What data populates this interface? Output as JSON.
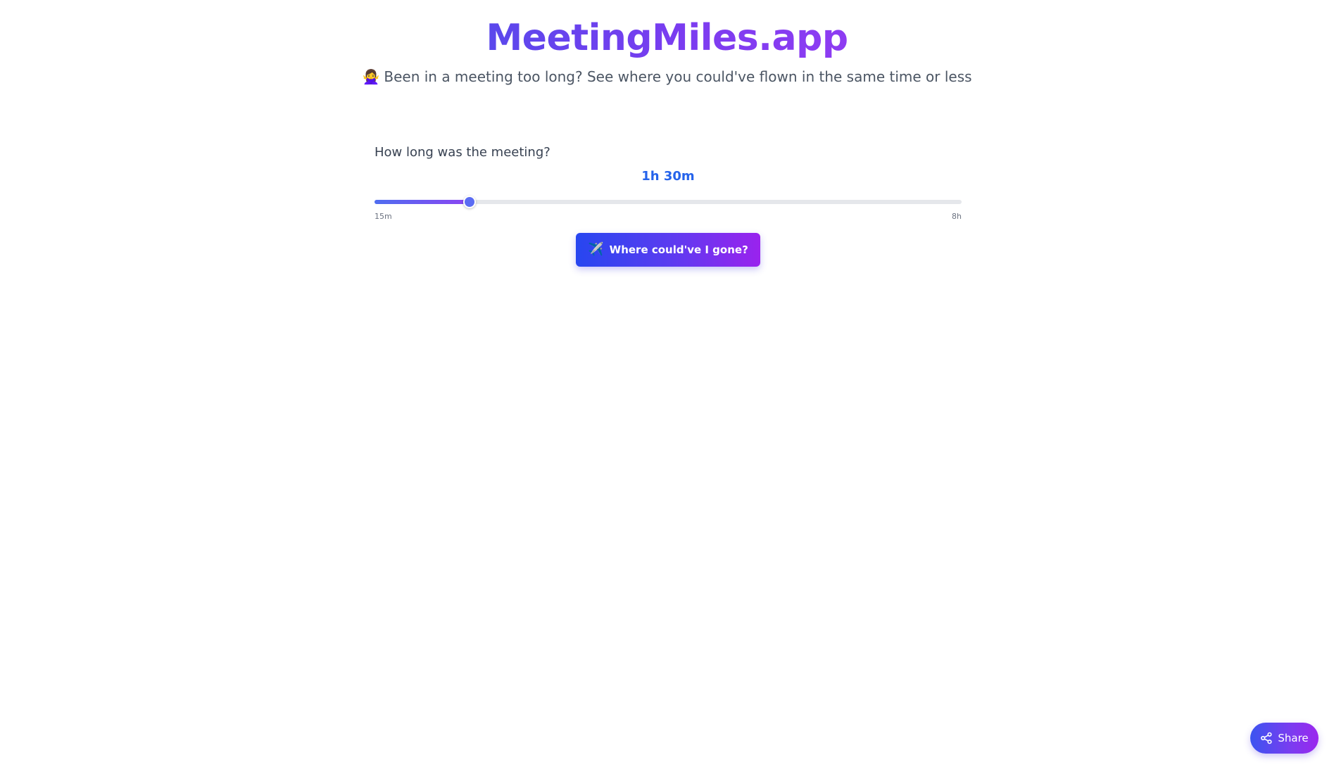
{
  "header": {
    "title": "MeetingMiles.app",
    "subtitle_icon": "person-gesturing-no-emoji",
    "subtitle_emoji": "🙅‍♀️",
    "subtitle": "Been in a meeting too long? See where you could've flown in the same time or less"
  },
  "duration": {
    "label": "How long was the meeting?",
    "value_display": "1h 30m",
    "value_minutes": 90,
    "min_minutes": 15,
    "max_minutes": 480,
    "min_label": "15m",
    "max_label": "8h"
  },
  "cta": {
    "icon": "airplane-icon",
    "icon_glyph": "✈️",
    "label": "Where could've I gone?"
  },
  "share": {
    "icon": "share-icon",
    "label": "Share"
  },
  "colors": {
    "title_gradient_start": "#5a48ec",
    "title_gradient_end": "#8e3cf2",
    "value_text": "#2563eb",
    "button_gradient_start": "#2746f0",
    "button_gradient_end": "#9a23ee",
    "track": "#e5e7eb",
    "thumb": "#5b6cf3"
  }
}
